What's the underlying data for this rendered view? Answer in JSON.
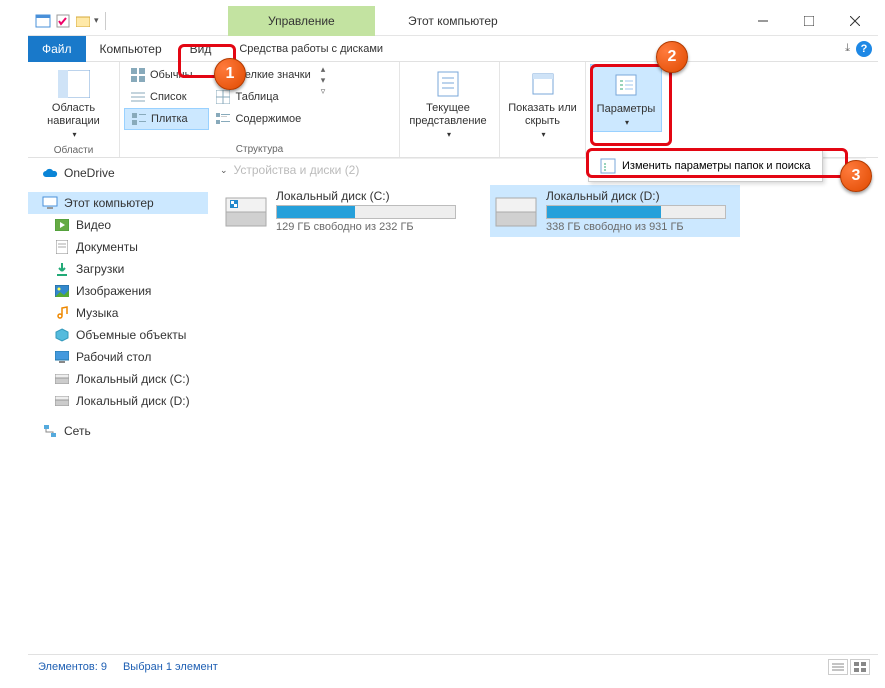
{
  "title": "Этот компьютер",
  "contextual_tab": "Управление",
  "tabs": {
    "file": "Файл",
    "computer": "Компьютер",
    "view": "Вид",
    "context_sub": "Средства работы с дисками"
  },
  "ribbon": {
    "panes_group": "Области",
    "nav_pane": "Область навигации",
    "layout_group": "Структура",
    "layout": {
      "usual": "Обычны…",
      "small_icons": "Мелкие значки",
      "list": "Список",
      "table": "Таблица",
      "tiles": "Плитка",
      "content": "Содержимое"
    },
    "current_view": "Текущее представление",
    "show_hide": "Показать или скрыть",
    "options": "Параметры",
    "options_menu_item": "Изменить параметры папок и поиска"
  },
  "nav": {
    "onedrive": "OneDrive",
    "this_pc": "Этот компьютер",
    "videos": "Видео",
    "documents": "Документы",
    "downloads": "Загрузки",
    "pictures": "Изображения",
    "music": "Музыка",
    "objects3d": "Объемные объекты",
    "desktop": "Рабочий стол",
    "disk_c": "Локальный диск (С:)",
    "disk_d": "Локальный диск (D:)",
    "network": "Сеть"
  },
  "content": {
    "group_header": "Устройства и диски (2)",
    "drives": [
      {
        "name": "Локальный диск (С:)",
        "sub": "129 ГБ свободно из 232 ГБ",
        "fill": 44,
        "selected": false
      },
      {
        "name": "Локальный диск (D:)",
        "sub": "338 ГБ свободно из 931 ГБ",
        "fill": 64,
        "selected": true
      }
    ]
  },
  "status": {
    "items": "Элементов: 9",
    "selected": "Выбран 1 элемент"
  }
}
